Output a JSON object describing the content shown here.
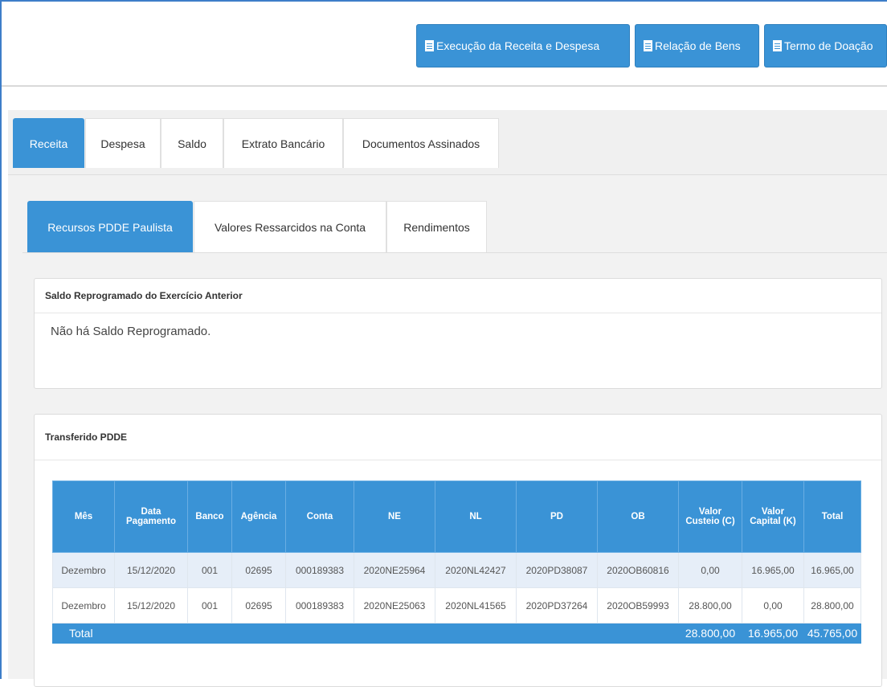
{
  "toolbar": {
    "buttons": [
      {
        "label": "Execução da Receita e Despesa",
        "icon": "pdf-document-icon"
      },
      {
        "label": "Relação de Bens",
        "icon": "pdf-document-icon"
      },
      {
        "label": "Termo de Doação",
        "icon": "pdf-document-icon"
      }
    ]
  },
  "main_tabs": [
    {
      "label": "Receita",
      "active": true
    },
    {
      "label": "Despesa",
      "active": false
    },
    {
      "label": "Saldo",
      "active": false
    },
    {
      "label": "Extrato Bancário",
      "active": false
    },
    {
      "label": "Documentos Assinados",
      "active": false
    }
  ],
  "sub_tabs": [
    {
      "label": "Recursos PDDE Paulista",
      "active": true
    },
    {
      "label": "Valores Ressarcidos na Conta",
      "active": false
    },
    {
      "label": "Rendimentos",
      "active": false
    }
  ],
  "saldo_card": {
    "title": "Saldo Reprogramado do Exercício Anterior",
    "message": "Não há Saldo Reprogramado."
  },
  "transferido_card": {
    "title": "Transferido PDDE",
    "columns": [
      "Mês",
      "Data Pagamento",
      "Banco",
      "Agência",
      "Conta",
      "NE",
      "NL",
      "PD",
      "OB",
      "Valor Custeio (C)",
      "Valor Capital (K)",
      "Total"
    ],
    "rows": [
      [
        "Dezembro",
        "15/12/2020",
        "001",
        "02695",
        "000189383",
        "2020NE25964",
        "2020NL42427",
        "2020PD38087",
        "2020OB60816",
        "0,00",
        "16.965,00",
        "16.965,00"
      ],
      [
        "Dezembro",
        "15/12/2020",
        "001",
        "02695",
        "000189383",
        "2020NE25063",
        "2020NL41565",
        "2020PD37264",
        "2020OB59993",
        "28.800,00",
        "0,00",
        "28.800,00"
      ]
    ],
    "total": {
      "label": "Total",
      "custeio": "28.800,00",
      "capital": "16.965,00",
      "total": "45.765,00"
    }
  },
  "colors": {
    "accent": "#3a93d6",
    "row_highlight": "#e6eef8",
    "panel_bg": "#f2f2f2"
  }
}
